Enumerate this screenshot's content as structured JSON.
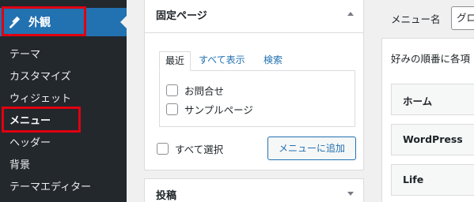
{
  "sidebar": {
    "head_label": "外観",
    "items": [
      {
        "label": "テーマ"
      },
      {
        "label": "カスタマイズ"
      },
      {
        "label": "ウィジェット"
      },
      {
        "label": "メニュー"
      },
      {
        "label": "ヘッダー"
      },
      {
        "label": "背景"
      },
      {
        "label": "テーマエディター"
      }
    ],
    "current_index": 3
  },
  "pages_panel": {
    "title": "固定ページ",
    "tabs": [
      "最近",
      "すべて表示",
      "検索"
    ],
    "active_tab": "最近",
    "items": [
      {
        "label": "お問合せ",
        "checked": false
      },
      {
        "label": "サンプルページ",
        "checked": false
      }
    ],
    "select_all_label": "すべて選択",
    "add_button_label": "メニューに追加"
  },
  "posts_panel": {
    "title": "投稿"
  },
  "right": {
    "menu_name_label": "メニュー名",
    "menu_name_value": "グロ",
    "order_text": "好みの順番に各項",
    "menu_items": [
      "ホーム",
      "WordPress",
      "Life"
    ]
  },
  "colors": {
    "sidebar_bg": "#23282d",
    "active_bg": "#2271b1",
    "highlight": "#e0000f",
    "link": "#2271b1"
  }
}
